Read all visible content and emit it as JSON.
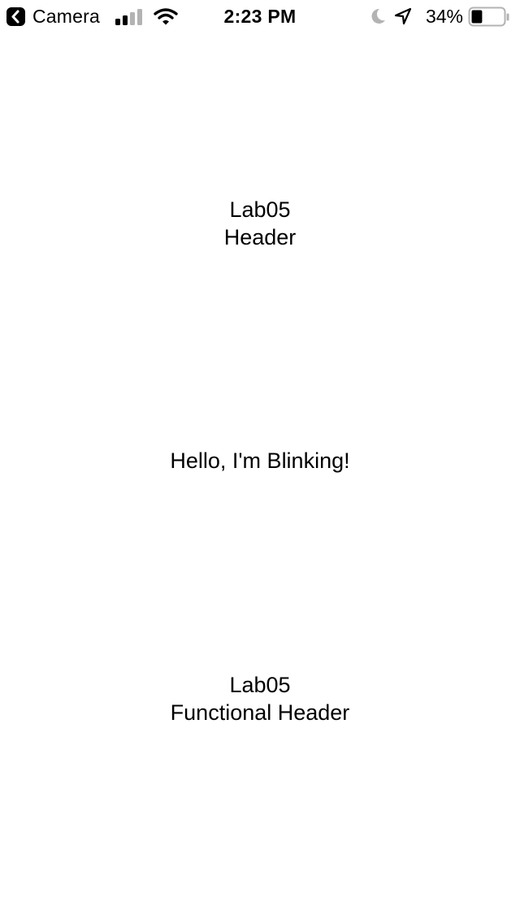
{
  "status_bar": {
    "back_app_label": "Camera",
    "time": "2:23 PM",
    "battery_percent": "34%",
    "battery_level": 0.34,
    "signal_bars_filled": 2,
    "signal_bars_total": 4,
    "icons": [
      "back-chevron-icon",
      "cellular-signal-icon",
      "wifi-icon",
      "moon-icon",
      "location-arrow-icon",
      "battery-icon"
    ]
  },
  "main": {
    "header": {
      "line1": "Lab05",
      "line2": "Header"
    },
    "blinking_text": "Hello, I'm Blinking!",
    "functional_header": {
      "line1": "Lab05",
      "line2": "Functional Header"
    }
  },
  "colors": {
    "background": "#ffffff",
    "text": "#000000",
    "inactive_icon": "#b3b3b3"
  }
}
